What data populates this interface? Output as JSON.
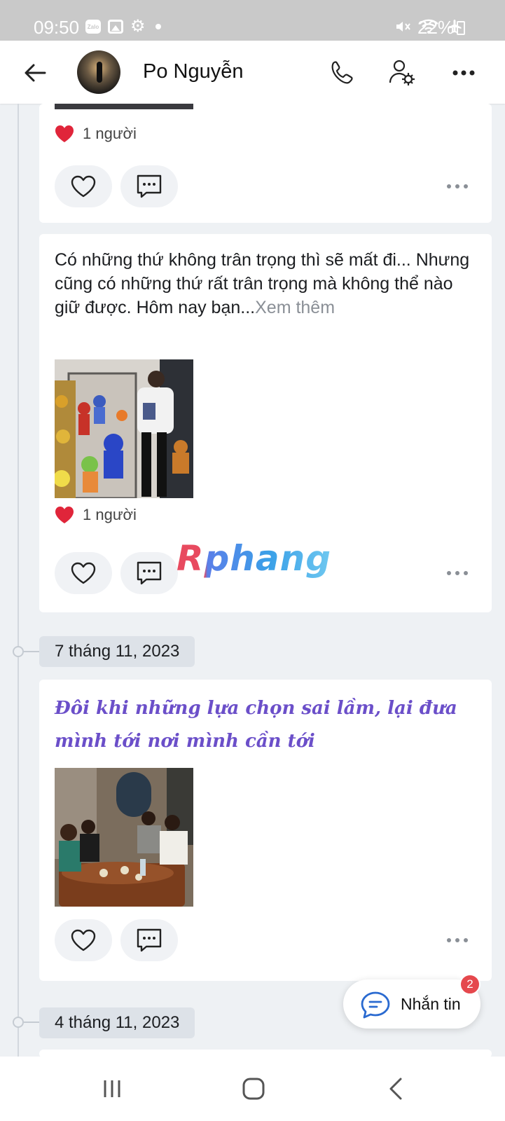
{
  "status_bar": {
    "time": "09:50",
    "battery": "22%",
    "zalo_label": "Zalo"
  },
  "header": {
    "title": "Po Nguyễn"
  },
  "posts": [
    {
      "likes": "1 người"
    },
    {
      "text": "Có những thứ không trân trọng thì sẽ mất đi... Nhưng cũng có những thứ rất trân trọng mà không thể nào giữ được. Hôm nay bạn...",
      "more_label": "Xem thêm",
      "likes": "1 người"
    },
    {
      "date": "7 tháng 11, 2023",
      "text": "Đôi khi những lựa chọn sai lầm, lại đưa mình tới nơi mình cần tới"
    },
    {
      "date": "4 tháng 11, 2023"
    }
  ],
  "watermark": "Rphang",
  "message_button": {
    "label": "Nhắn tin",
    "badge": "2"
  },
  "colors": {
    "accent": "#6b4fc9",
    "badge": "#e5484d",
    "like_red": "#e0253a"
  }
}
